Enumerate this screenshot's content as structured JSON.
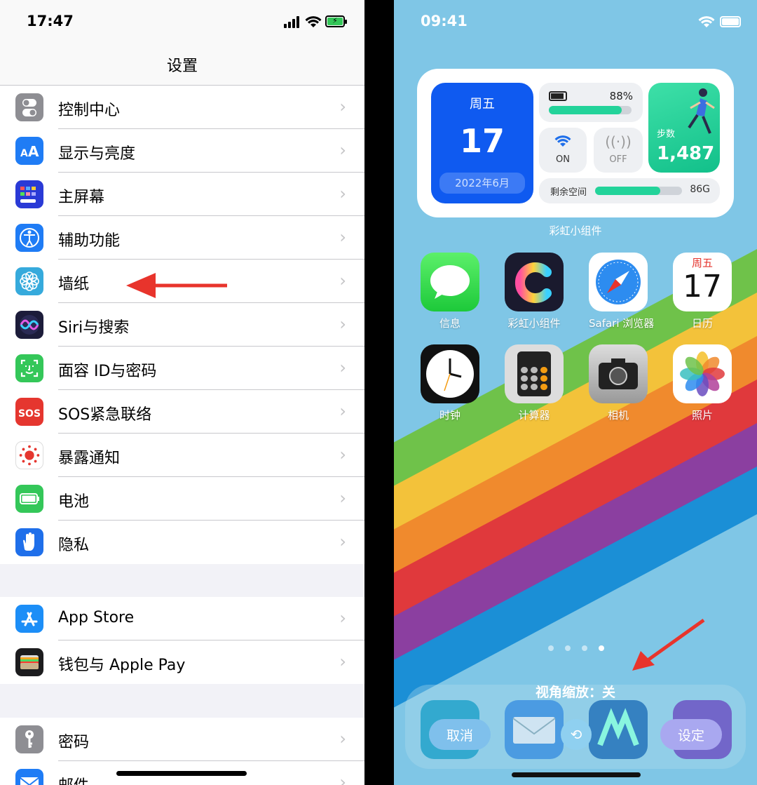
{
  "left": {
    "status_time": "17:47",
    "nav_title": "设置",
    "group1": [
      {
        "label": "控制中心",
        "icon": "toggle-icon",
        "color": "#8e8e93"
      },
      {
        "label": "显示与亮度",
        "icon": "text-size-icon",
        "color": "#1f7cf5"
      },
      {
        "label": "主屏幕",
        "icon": "home-grid-icon",
        "color": "#2a3ad6"
      },
      {
        "label": "辅助功能",
        "icon": "accessibility-icon",
        "color": "#1f7cf5"
      },
      {
        "label": "墙纸",
        "icon": "flower-icon",
        "color": "#36aadc"
      },
      {
        "label": "Siri与搜索",
        "icon": "siri-icon",
        "color": "#1c1c3a"
      },
      {
        "label": "面容 ID与密码",
        "icon": "face-id-icon",
        "color": "#34c759"
      },
      {
        "label": "SOS紧急联络",
        "icon": "sos-icon",
        "color": "#e5362f"
      },
      {
        "label": "暴露通知",
        "icon": "exposure-icon",
        "color": "#ffffff"
      },
      {
        "label": "电池",
        "icon": "battery-icon",
        "color": "#34c759"
      },
      {
        "label": "隐私",
        "icon": "hand-icon",
        "color": "#1f6fea"
      }
    ],
    "group2": [
      {
        "label": "App Store",
        "icon": "app-store-icon",
        "color": "#1c8ef7"
      },
      {
        "label": "钱包与 Apple Pay",
        "icon": "wallet-icon",
        "color": "#1c1c1e"
      }
    ],
    "group3": [
      {
        "label": "密码",
        "icon": "key-icon",
        "color": "#8e8e93"
      },
      {
        "label": "邮件",
        "icon": "mail-icon",
        "color": "#1f7cf5"
      }
    ],
    "chevron": "›"
  },
  "right": {
    "status_time": "09:41",
    "widget": {
      "weekday": "周五",
      "day": "17",
      "month": "2022年6月",
      "battery_pct": "88%",
      "battery_level": 0.88,
      "wifi_state": "ON",
      "cellular_state": "OFF",
      "steps_label": "步数",
      "steps_value": "1,487",
      "storage_label": "剩余空间",
      "storage_value": "86G",
      "storage_level": 0.75,
      "caption": "彩虹小组件"
    },
    "apps_row1": [
      {
        "name": "信息",
        "icon": "messages-icon"
      },
      {
        "name": "彩虹小组件",
        "icon": "rainbow-widget-icon"
      },
      {
        "name": "Safari 浏览器",
        "icon": "safari-icon"
      },
      {
        "name": "日历",
        "icon": "calendar-icon",
        "weekday": "周五",
        "day": "17"
      }
    ],
    "apps_row2": [
      {
        "name": "时钟",
        "icon": "clock-icon"
      },
      {
        "name": "计算器",
        "icon": "calculator-icon"
      },
      {
        "name": "相机",
        "icon": "camera-icon"
      },
      {
        "name": "照片",
        "icon": "photos-icon"
      }
    ],
    "page_dots": 4,
    "active_dot": 3,
    "perspective_zoom": "视角缩放：关",
    "cancel_label": "取消",
    "set_label": "设定"
  }
}
